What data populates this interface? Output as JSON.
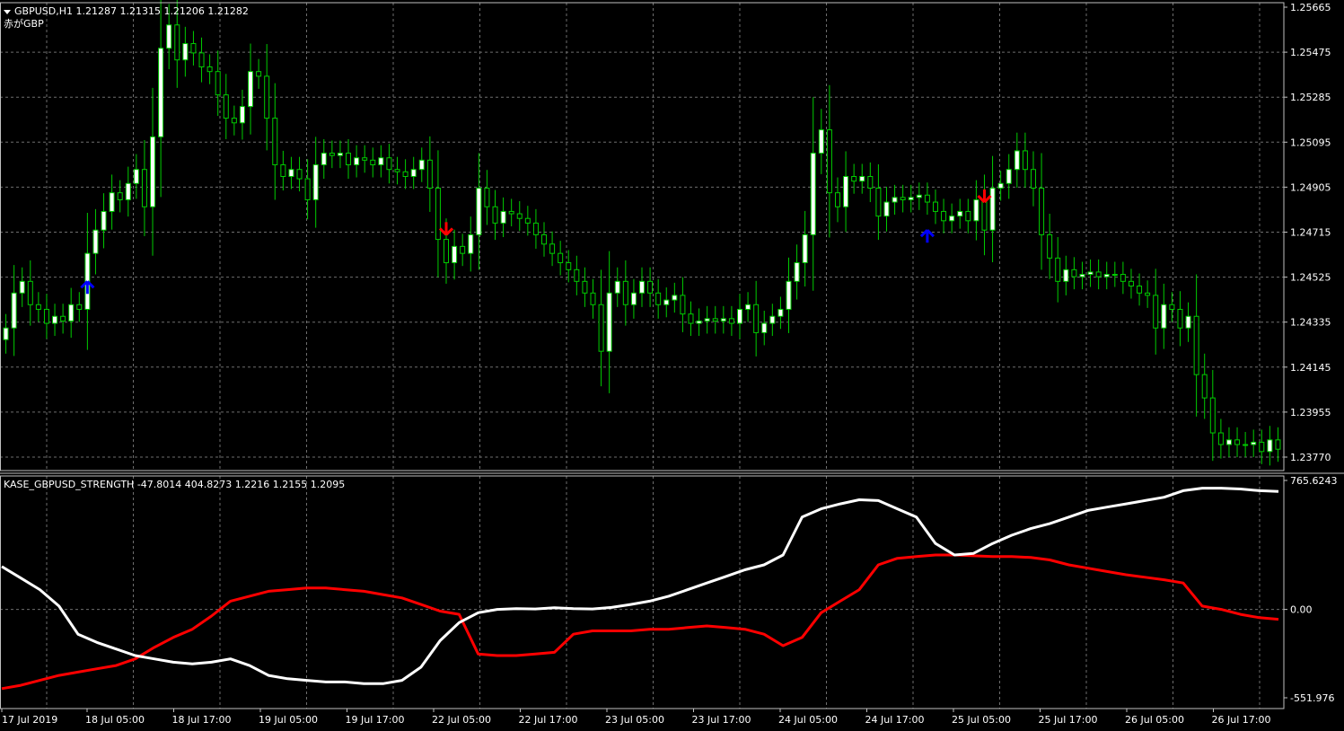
{
  "main_chart": {
    "symbol_line": "GBPUSD,H1  1.21287 1.21315 1.21206 1.21282",
    "subtitle": "赤がGBP",
    "price_labels": [
      "1.25665",
      "1.25475",
      "1.25285",
      "1.25095",
      "1.24905",
      "1.24715",
      "1.24525",
      "1.24335",
      "1.24145",
      "1.23955",
      "1.23770"
    ],
    "arrows": [
      {
        "direction": "up",
        "color": "#0000ff",
        "index": 10
      },
      {
        "direction": "down",
        "color": "#ff0000",
        "index": 54
      },
      {
        "direction": "up",
        "color": "#0000ff",
        "index": 113
      },
      {
        "direction": "down",
        "color": "#ff0000",
        "index": 120
      }
    ]
  },
  "indicator": {
    "title": "KASE_GBPUSD_STRENGTH -47.8014 404.8273 1.2216 1.2155 1.2095",
    "levels": [
      "765.6243",
      "0.00",
      "-551.976"
    ]
  },
  "time_labels": [
    "17 Jul 2019",
    "18 Jul 05:00",
    "18 Jul 17:00",
    "19 Jul 05:00",
    "19 Jul 17:00",
    "22 Jul 05:00",
    "22 Jul 17:00",
    "23 Jul 05:00",
    "23 Jul 17:00",
    "24 Jul 05:00",
    "24 Jul 17:00",
    "25 Jul 05:00",
    "25 Jul 17:00",
    "26 Jul 05:00",
    "26 Jul 17:00"
  ],
  "colors": {
    "background": "#000000",
    "grid": "#6e6e6e",
    "bull_candle": "#ffffff",
    "wick": "#00cc00",
    "gbp_line": "#ff0000",
    "usd_line": "#ffffff"
  },
  "chart_data": {
    "type": "candlestick",
    "symbol": "GBPUSD",
    "timeframe": "H1",
    "y_range": [
      1.2375,
      1.2568
    ],
    "close": [
      1.243,
      1.2445,
      1.245,
      1.244,
      1.2438,
      1.2432,
      1.2435,
      1.2433,
      1.244,
      1.2438,
      1.2462,
      1.2472,
      1.248,
      1.2488,
      1.2485,
      1.2492,
      1.2498,
      1.2482,
      1.2512,
      1.255,
      1.256,
      1.2545,
      1.2552,
      1.2548,
      1.2542,
      1.254,
      1.253,
      1.252,
      1.2518,
      1.2525,
      1.254,
      1.2538,
      1.252,
      1.25,
      1.2495,
      1.2498,
      1.2494,
      1.2485,
      1.25,
      1.2505,
      1.2504,
      1.2505,
      1.25,
      1.2503,
      1.2502,
      1.25,
      1.2503,
      1.2498,
      1.2497,
      1.2495,
      1.2498,
      1.2502,
      1.249,
      1.2468,
      1.2458,
      1.2465,
      1.2462,
      1.247,
      1.249,
      1.2482,
      1.2475,
      1.248,
      1.2479,
      1.2477,
      1.2475,
      1.247,
      1.2466,
      1.2462,
      1.2458,
      1.2455,
      1.245,
      1.2445,
      1.244,
      1.242,
      1.2445,
      1.245,
      1.244,
      1.2445,
      1.245,
      1.2445,
      1.244,
      1.2442,
      1.2444,
      1.2436,
      1.2432,
      1.2433,
      1.2434,
      1.2433,
      1.2434,
      1.2432,
      1.2438,
      1.244,
      1.2428,
      1.2432,
      1.2435,
      1.2438,
      1.245,
      1.2458,
      1.247,
      1.2505,
      1.2515,
      1.2488,
      1.2482,
      1.2495,
      1.2493,
      1.2495,
      1.249,
      1.2478,
      1.2484,
      1.2486,
      1.2485,
      1.2486,
      1.2487,
      1.2484,
      1.248,
      1.2476,
      1.2478,
      1.248,
      1.2476,
      1.2485,
      1.2472,
      1.249,
      1.2492,
      1.2498,
      1.2506,
      1.2498,
      1.249,
      1.247,
      1.246,
      1.245,
      1.2455,
      1.2452,
      1.2453,
      1.2454,
      1.2452,
      1.2453,
      1.2453,
      1.245,
      1.2448,
      1.2445,
      1.2444,
      1.243,
      1.244,
      1.2438,
      1.243,
      1.2435,
      1.241,
      1.24,
      1.2385,
      1.238,
      1.2382,
      1.238,
      1.238,
      1.2381,
      1.2377,
      1.2382,
      1.2378
    ],
    "indicator": {
      "name": "KASE_GBPUSD_STRENGTH",
      "y_range": [
        -551.976,
        765.6243
      ],
      "series": [
        {
          "name": "GBP",
          "color": "#ff0000",
          "values": [
            -480,
            -460,
            -430,
            -400,
            -380,
            -360,
            -340,
            -300,
            -230,
            -170,
            -120,
            -40,
            50,
            80,
            110,
            120,
            130,
            130,
            120,
            110,
            90,
            70,
            30,
            -10,
            -30,
            -270,
            -280,
            -280,
            -270,
            -260,
            -150,
            -130,
            -130,
            -130,
            -120,
            -120,
            -110,
            -100,
            -110,
            -120,
            -150,
            -220,
            -170,
            -20,
            50,
            120,
            270,
            310,
            320,
            330,
            330,
            325,
            320,
            320,
            315,
            300,
            270,
            250,
            230,
            210,
            195,
            180,
            160,
            20,
            0,
            -30,
            -50,
            -60
          ]
        },
        {
          "name": "USD",
          "color": "#ffffff",
          "values": [
            260,
            190,
            120,
            20,
            -150,
            -200,
            -240,
            -280,
            -300,
            -320,
            -330,
            -320,
            -300,
            -340,
            -400,
            -420,
            -430,
            -440,
            -440,
            -450,
            -450,
            -430,
            -350,
            -190,
            -80,
            -20,
            0,
            5,
            3,
            10,
            5,
            3,
            12,
            30,
            50,
            80,
            120,
            160,
            200,
            240,
            270,
            330,
            560,
            610,
            640,
            665,
            660,
            610,
            560,
            400,
            330,
            340,
            400,
            450,
            490,
            520,
            560,
            600,
            620,
            640,
            660,
            680,
            720,
            735,
            735,
            730,
            720,
            715
          ]
        }
      ]
    }
  }
}
